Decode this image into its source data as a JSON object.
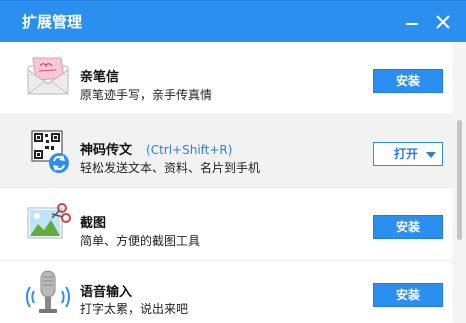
{
  "window": {
    "title": "扩展管理"
  },
  "titlebar_buttons": {
    "minimize_icon": "minimize-icon",
    "close_icon": "close-icon"
  },
  "extensions": [
    {
      "name": "亲笔信",
      "shortcut": "",
      "description": "原笔迹手写，亲手传真情",
      "action": "安装",
      "icon": "envelope-letter-icon"
    },
    {
      "name": "神码传文",
      "shortcut": "(Ctrl+Shift+R)",
      "description": "轻松发送文本、资料、名片到手机",
      "action": "打开",
      "icon": "qr-code-sync-icon"
    },
    {
      "name": "截图",
      "shortcut": "",
      "description": "简单、方便的截图工具",
      "action": "安装",
      "icon": "screenshot-scissors-icon"
    },
    {
      "name": "语音输入",
      "shortcut": "",
      "description": "打字太累，说出来吧",
      "action": "安装",
      "icon": "microphone-icon"
    }
  ],
  "colors": {
    "titlebar": "#2b8ff0",
    "accent": "#2b7fe3",
    "highlight_row": "#f2f2f2"
  }
}
